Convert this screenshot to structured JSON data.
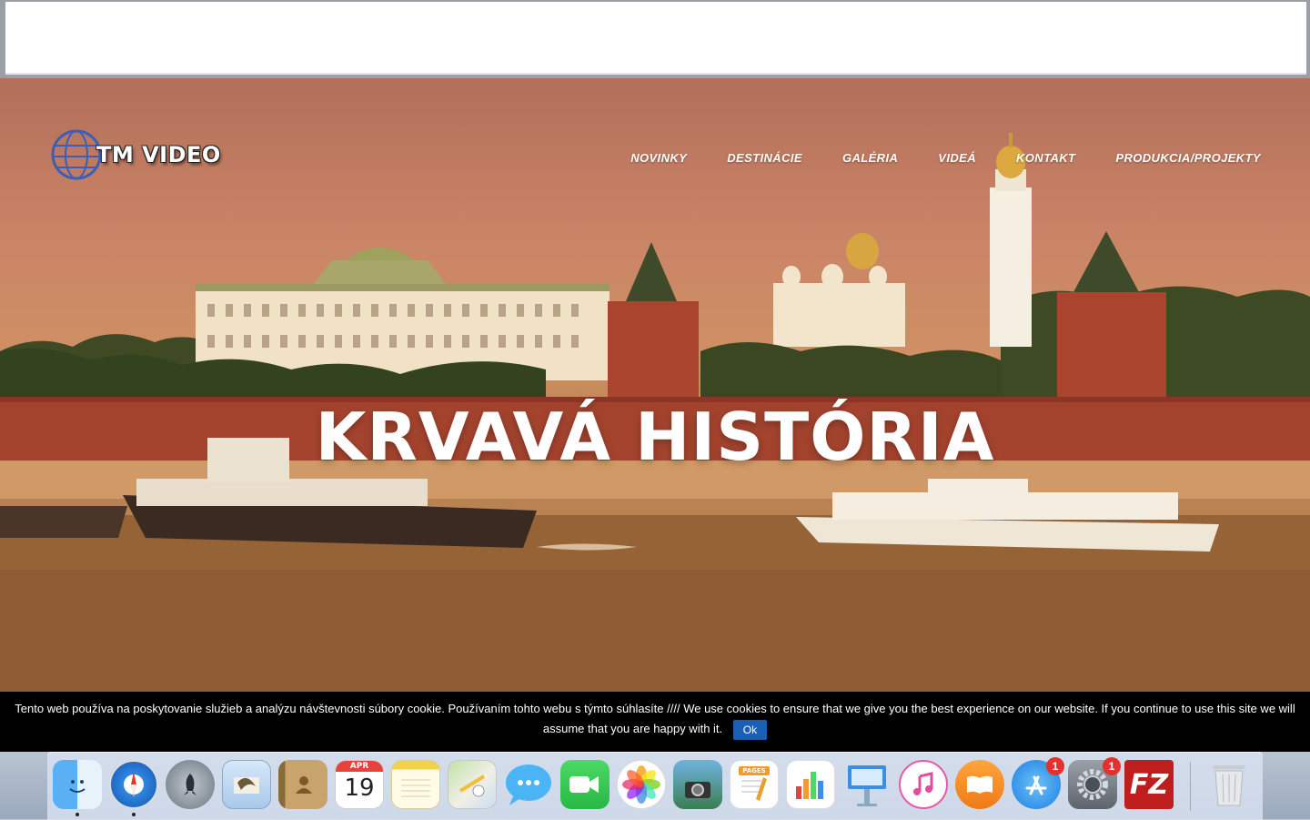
{
  "site": {
    "logo_text": "TM VIDEO",
    "nav": [
      "NOVINKY",
      "DESTINÁCIE",
      "GALÉRIA",
      "VIDEÁ",
      "KONTAKT",
      "PRODUKCIA/PROJEKTY"
    ],
    "headline": "KRVAVÁ HISTÓRIA"
  },
  "cookie": {
    "message": "Tento web používa na poskytovanie služieb a analýzu návštevnosti súbory cookie. Používaním tohto webu s týmto súhlasíte //// We use cookies to ensure that we give you the best experience on our website. If you continue to use this site we will assume that you are happy with it.",
    "ok_label": "Ok"
  },
  "dock": {
    "calendar_month": "APR",
    "calendar_day": "19",
    "appstore_badge": "1",
    "settings_badge": "1",
    "pages_label": "PAGES",
    "filezilla_label": "FZ",
    "items": [
      "finder-icon",
      "safari-icon",
      "launchpad-icon",
      "mail-icon",
      "contacts-icon",
      "calendar-icon",
      "notes-icon",
      "maps-icon",
      "messages-icon",
      "facetime-icon",
      "photos-icon",
      "image-capture-icon",
      "pages-icon",
      "numbers-icon",
      "keynote-icon",
      "itunes-icon",
      "ibooks-icon",
      "app-store-icon",
      "system-preferences-icon",
      "filezilla-icon",
      "trash-icon"
    ]
  },
  "colors": {
    "cookie_button": "#1a5fb4",
    "badge": "#e5302b",
    "hero_tint": "#c98466"
  }
}
